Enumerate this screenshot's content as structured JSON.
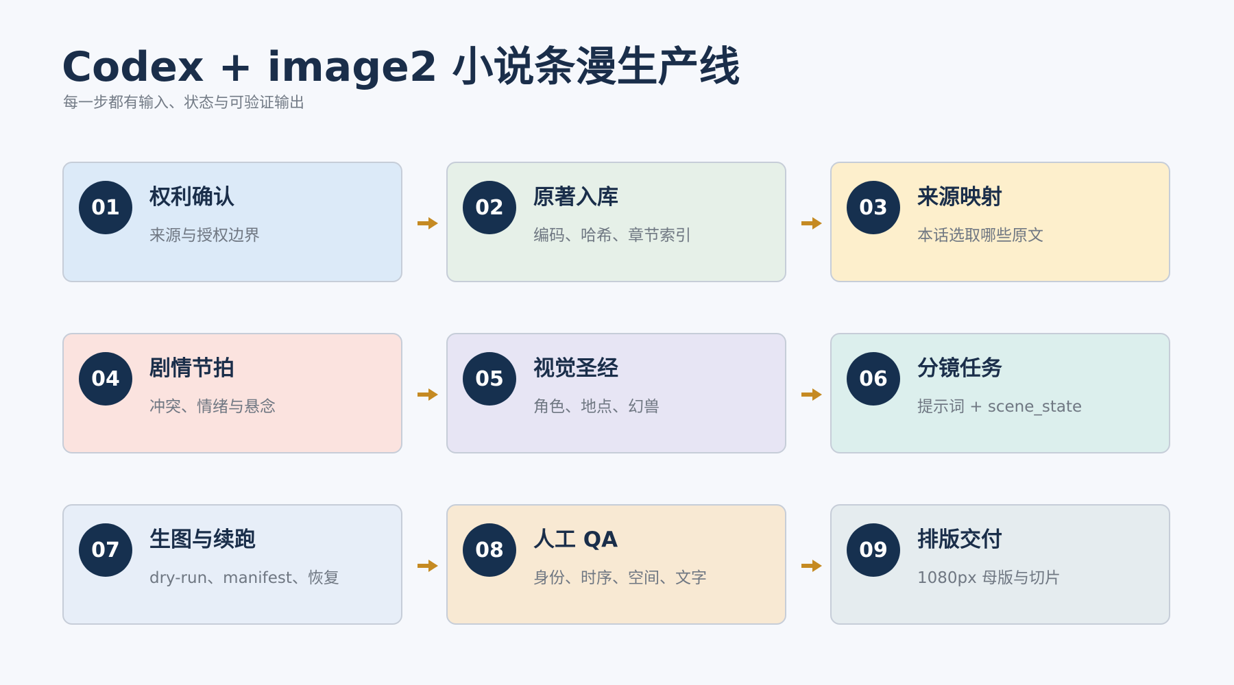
{
  "header": {
    "title": "Codex + image2 小说条漫生产线",
    "subtitle": "每一步都有输入、状态与可验证输出"
  },
  "colors": {
    "badge": "#16304f",
    "arrow": "#c58a22",
    "title": "#1a2e4a",
    "border": "#c6cdd8"
  },
  "steps": [
    {
      "number": "01",
      "title": "权利确认",
      "desc": "来源与授权边界",
      "color": "#dceaf8"
    },
    {
      "number": "02",
      "title": "原著入库",
      "desc": "编码、哈希、章节索引",
      "color": "#e6f0e8"
    },
    {
      "number": "03",
      "title": "来源映射",
      "desc": "本话选取哪些原文",
      "color": "#fdefcc"
    },
    {
      "number": "04",
      "title": "剧情节拍",
      "desc": "冲突、情绪与悬念",
      "color": "#fbe3df"
    },
    {
      "number": "05",
      "title": "视觉圣经",
      "desc": "角色、地点、幻兽",
      "color": "#e7e5f4"
    },
    {
      "number": "06",
      "title": "分镜任务",
      "desc": "提示词 + scene_state",
      "color": "#dcefed"
    },
    {
      "number": "07",
      "title": "生图与续跑",
      "desc": "dry-run、manifest、恢复",
      "color": "#e7eef8"
    },
    {
      "number": "08",
      "title": "人工 QA",
      "desc": "身份、时序、空间、文字",
      "color": "#f8e9d3"
    },
    {
      "number": "09",
      "title": "排版交付",
      "desc": "1080px 母版与切片",
      "color": "#e5ecef"
    }
  ]
}
